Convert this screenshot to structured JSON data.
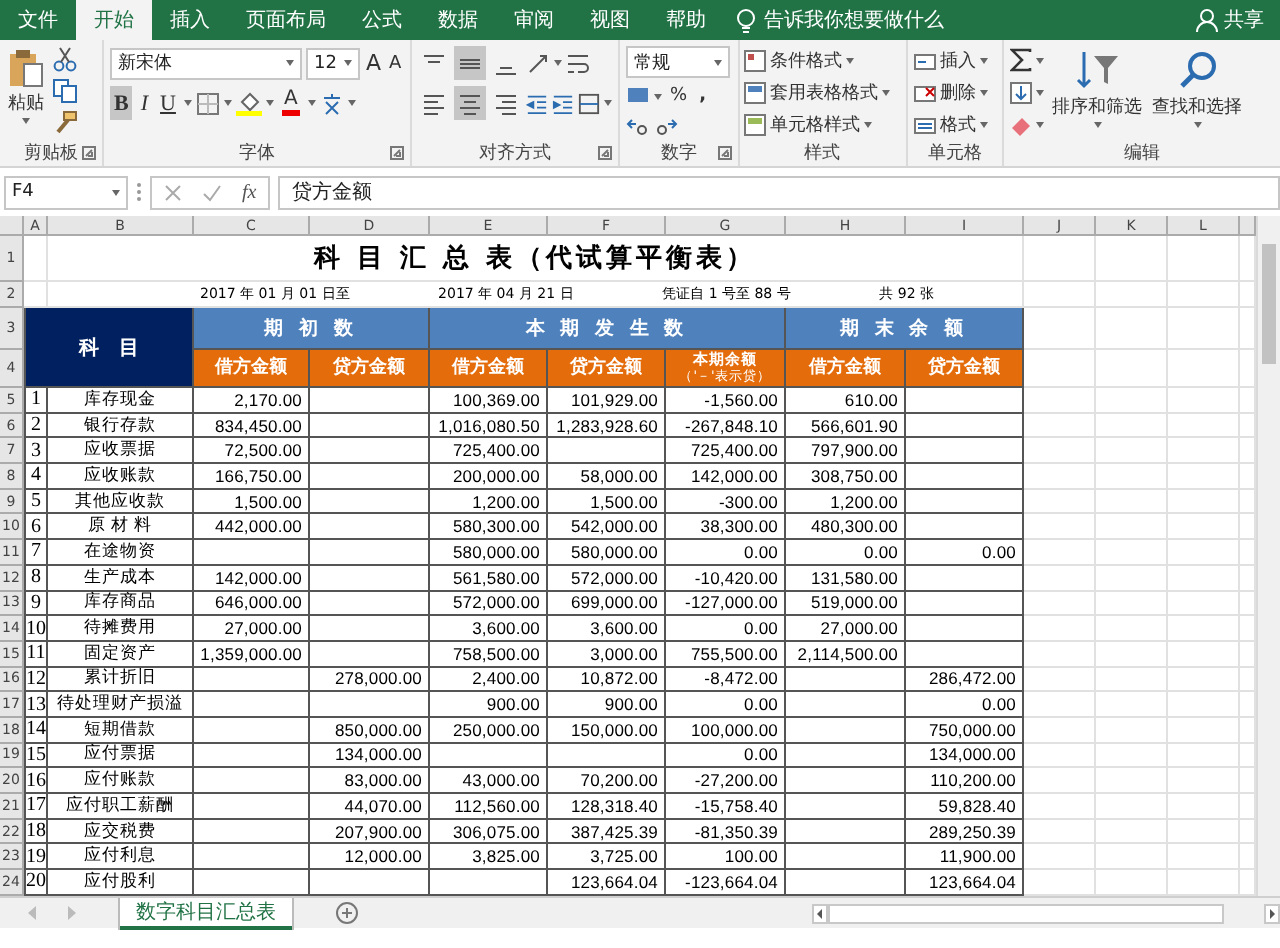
{
  "menu_tabs": [
    {
      "label": "文件",
      "selected": false
    },
    {
      "label": "开始",
      "selected": true
    },
    {
      "label": "插入",
      "selected": false
    },
    {
      "label": "页面布局",
      "selected": false
    },
    {
      "label": "公式",
      "selected": false
    },
    {
      "label": "数据",
      "selected": false
    },
    {
      "label": "审阅",
      "selected": false
    },
    {
      "label": "视图",
      "selected": false
    },
    {
      "label": "帮助",
      "selected": false
    }
  ],
  "tell_me": "告诉我你想要做什么",
  "share": "共享",
  "ribbon": {
    "clipboard": {
      "paste": "粘贴",
      "label": "剪贴板"
    },
    "font": {
      "name": "新宋体",
      "size": "12",
      "grow": "A",
      "shrink": "A",
      "styles": [
        {
          "kind": "bold",
          "label": "B",
          "selected": true
        },
        {
          "kind": "italic",
          "label": "I",
          "selected": false
        },
        {
          "kind": "underline",
          "label": "U",
          "selected": false
        }
      ],
      "font_color": "A",
      "label": "字体"
    },
    "alignment": {
      "vertical": [
        {
          "kind": "top",
          "selected": false
        },
        {
          "kind": "middle",
          "selected": true
        },
        {
          "kind": "bottom",
          "selected": false
        }
      ],
      "horizontal": [
        {
          "kind": "left",
          "selected": false
        },
        {
          "kind": "center",
          "selected": true
        },
        {
          "kind": "right",
          "selected": false
        }
      ],
      "label": "对齐方式"
    },
    "number": {
      "format": "常规",
      "percent": "%",
      "comma": ",",
      "label": "数字"
    },
    "styles": {
      "items": [
        "条件格式",
        "套用表格格式",
        "单元格样式"
      ],
      "label": "样式"
    },
    "cells": {
      "items": [
        "插入",
        "删除",
        "格式"
      ],
      "label": "单元格"
    },
    "editing": {
      "sort": "排序和筛选",
      "find": "查找和选择",
      "label": "编辑"
    }
  },
  "formula_bar": {
    "name_box": "F4",
    "function_label": "fx",
    "formula": "贷方金额"
  },
  "column_headers": [
    "A",
    "B",
    "C",
    "D",
    "E",
    "F",
    "G",
    "H",
    "I",
    "J",
    "K",
    "L"
  ],
  "row_headers": [
    "1",
    "2",
    "3",
    "4",
    "5",
    "6",
    "7",
    "8",
    "9",
    "10",
    "11",
    "12",
    "13",
    "14",
    "15",
    "16",
    "17",
    "18",
    "19",
    "20",
    "21",
    "22",
    "23",
    "24"
  ],
  "sheet": {
    "title": "科 目 汇 总 表（代试算平衡表）",
    "date_line": [
      "2017 年 01 月 01 日至",
      "2017 年 04 月 21 日",
      "凭证自 1 号至 88 号",
      "共 92 张"
    ],
    "subject_header": "科　目",
    "groups": [
      "期 初 数",
      "本 期 发 生 数",
      "期 末 余 额"
    ],
    "subheaders": [
      {
        "lines": [
          "借方金额"
        ]
      },
      {
        "lines": [
          "贷方金额"
        ]
      },
      {
        "lines": [
          "借方金额"
        ]
      },
      {
        "lines": [
          "贷方金额"
        ]
      },
      {
        "lines": [
          "本期余额",
          "（'－'表示贷）"
        ]
      },
      {
        "lines": [
          "借方金额"
        ]
      },
      {
        "lines": [
          "贷方金额"
        ]
      }
    ],
    "rows": [
      {
        "index": "1",
        "name": "库存现金",
        "opening_debit": "2,170.00",
        "period_debit": "100,369.00",
        "period_credit": "101,929.00",
        "period_balance": "-1,560.00",
        "closing_debit": "610.00"
      },
      {
        "index": "2",
        "name": "银行存款",
        "opening_debit": "834,450.00",
        "period_debit": "1,016,080.50",
        "period_credit": "1,283,928.60",
        "period_balance": "-267,848.10",
        "closing_debit": "566,601.90"
      },
      {
        "index": "3",
        "name": "应收票据",
        "opening_debit": "72,500.00",
        "period_debit": "725,400.00",
        "period_balance": "725,400.00",
        "closing_debit": "797,900.00"
      },
      {
        "index": "4",
        "name": "应收账款",
        "opening_debit": "166,750.00",
        "period_debit": "200,000.00",
        "period_credit": "58,000.00",
        "period_balance": "142,000.00",
        "closing_debit": "308,750.00"
      },
      {
        "index": "5",
        "name": "其他应收款",
        "opening_debit": "1,500.00",
        "period_debit": "1,200.00",
        "period_credit": "1,500.00",
        "period_balance": "-300.00",
        "closing_debit": "1,200.00"
      },
      {
        "index": "6",
        "name": "原 材 料",
        "opening_debit": "442,000.00",
        "period_debit": "580,300.00",
        "period_credit": "542,000.00",
        "period_balance": "38,300.00",
        "closing_debit": "480,300.00"
      },
      {
        "index": "7",
        "name": "在途物资",
        "period_debit": "580,000.00",
        "period_credit": "580,000.00",
        "period_balance": "0.00",
        "closing_debit": "0.00",
        "closing_credit": "0.00"
      },
      {
        "index": "8",
        "name": "生产成本",
        "opening_debit": "142,000.00",
        "period_debit": "561,580.00",
        "period_credit": "572,000.00",
        "period_balance": "-10,420.00",
        "closing_debit": "131,580.00"
      },
      {
        "index": "9",
        "name": "库存商品",
        "opening_debit": "646,000.00",
        "period_debit": "572,000.00",
        "period_credit": "699,000.00",
        "period_balance": "-127,000.00",
        "closing_debit": "519,000.00"
      },
      {
        "index": "10",
        "name": "待摊费用",
        "opening_debit": "27,000.00",
        "period_debit": "3,600.00",
        "period_credit": "3,600.00",
        "period_balance": "0.00",
        "closing_debit": "27,000.00"
      },
      {
        "index": "11",
        "name": "固定资产",
        "opening_debit": "1,359,000.00",
        "period_debit": "758,500.00",
        "period_credit": "3,000.00",
        "period_balance": "755,500.00",
        "closing_debit": "2,114,500.00"
      },
      {
        "index": "12",
        "name": "累计折旧",
        "opening_credit": "278,000.00",
        "period_debit": "2,400.00",
        "period_credit": "10,872.00",
        "period_balance": "-8,472.00",
        "closing_credit": "286,472.00"
      },
      {
        "index": "13",
        "name": "待处理财产损溢",
        "period_debit": "900.00",
        "period_credit": "900.00",
        "period_balance": "0.00",
        "closing_credit": "0.00"
      },
      {
        "index": "14",
        "name": "短期借款",
        "opening_credit": "850,000.00",
        "period_debit": "250,000.00",
        "period_credit": "150,000.00",
        "period_balance": "100,000.00",
        "closing_credit": "750,000.00"
      },
      {
        "index": "15",
        "name": "应付票据",
        "opening_credit": "134,000.00",
        "period_balance": "0.00",
        "closing_credit": "134,000.00"
      },
      {
        "index": "16",
        "name": "应付账款",
        "opening_credit": "83,000.00",
        "period_debit": "43,000.00",
        "period_credit": "70,200.00",
        "period_balance": "-27,200.00",
        "closing_credit": "110,200.00"
      },
      {
        "index": "17",
        "name": "应付职工薪酬",
        "opening_credit": "44,070.00",
        "period_debit": "112,560.00",
        "period_credit": "128,318.40",
        "period_balance": "-15,758.40",
        "closing_credit": "59,828.40"
      },
      {
        "index": "18",
        "name": "应交税费",
        "opening_credit": "207,900.00",
        "period_debit": "306,075.00",
        "period_credit": "387,425.39",
        "period_balance": "-81,350.39",
        "closing_credit": "289,250.39"
      },
      {
        "index": "19",
        "name": "应付利息",
        "opening_credit": "12,000.00",
        "period_debit": "3,825.00",
        "period_credit": "3,725.00",
        "period_balance": "100.00",
        "closing_credit": "11,900.00"
      },
      {
        "index": "20",
        "name": "应付股利",
        "period_credit": "123,664.04",
        "period_balance": "-123,664.04",
        "closing_credit": "123,664.04"
      }
    ]
  },
  "sheet_tabs": [
    {
      "label": "数字科目汇总表",
      "selected": true
    }
  ]
}
